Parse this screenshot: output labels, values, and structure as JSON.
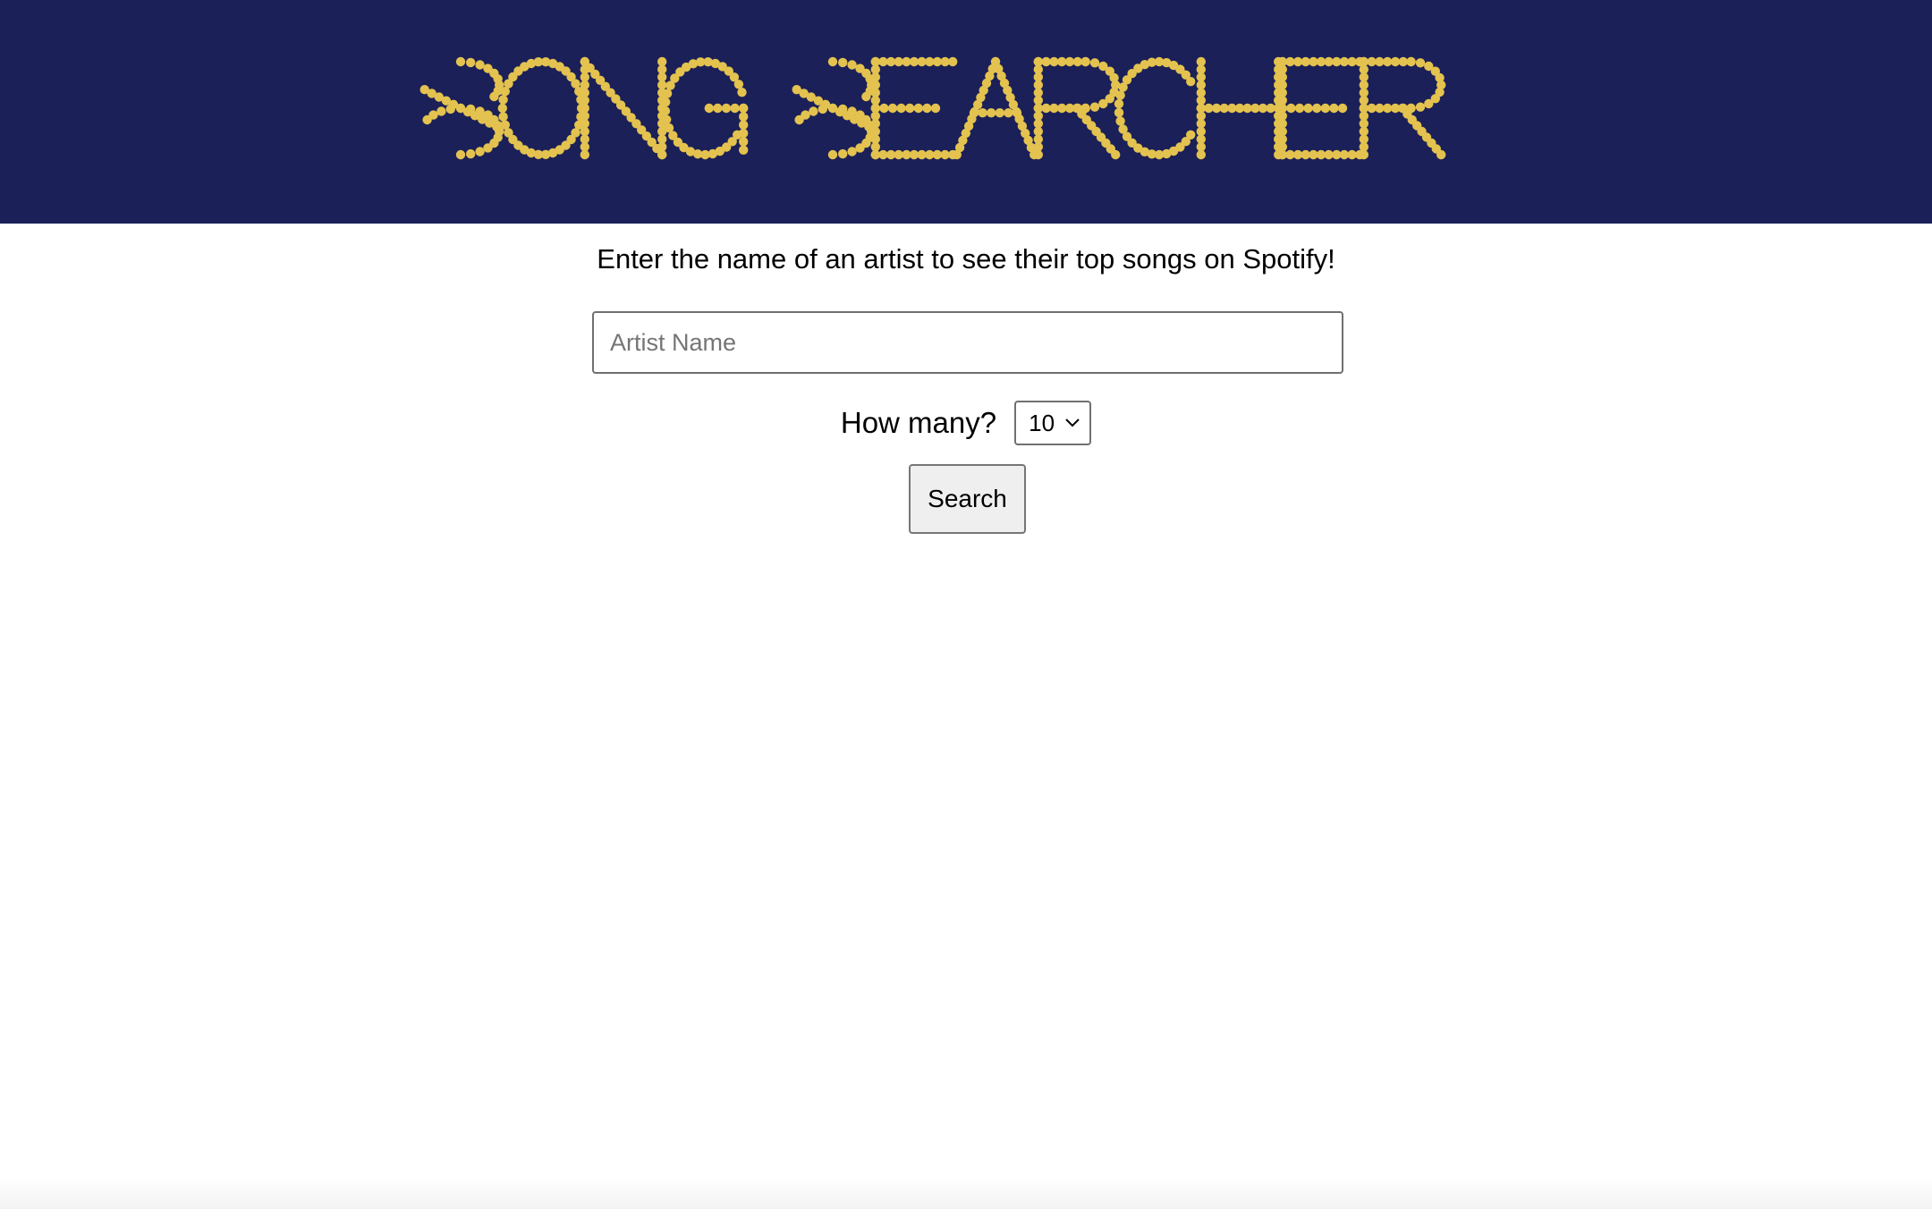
{
  "header": {
    "logo_text": "SONG SEARCHER",
    "background_color": "#1b2058",
    "dot_color": "#e3c24f"
  },
  "intro": {
    "text": "Enter the name of an artist to see their top songs on Spotify!"
  },
  "search": {
    "artist_placeholder": "Artist Name",
    "artist_value": "",
    "count_label": "How many?",
    "count_selected": "10",
    "button_label": "Search"
  }
}
